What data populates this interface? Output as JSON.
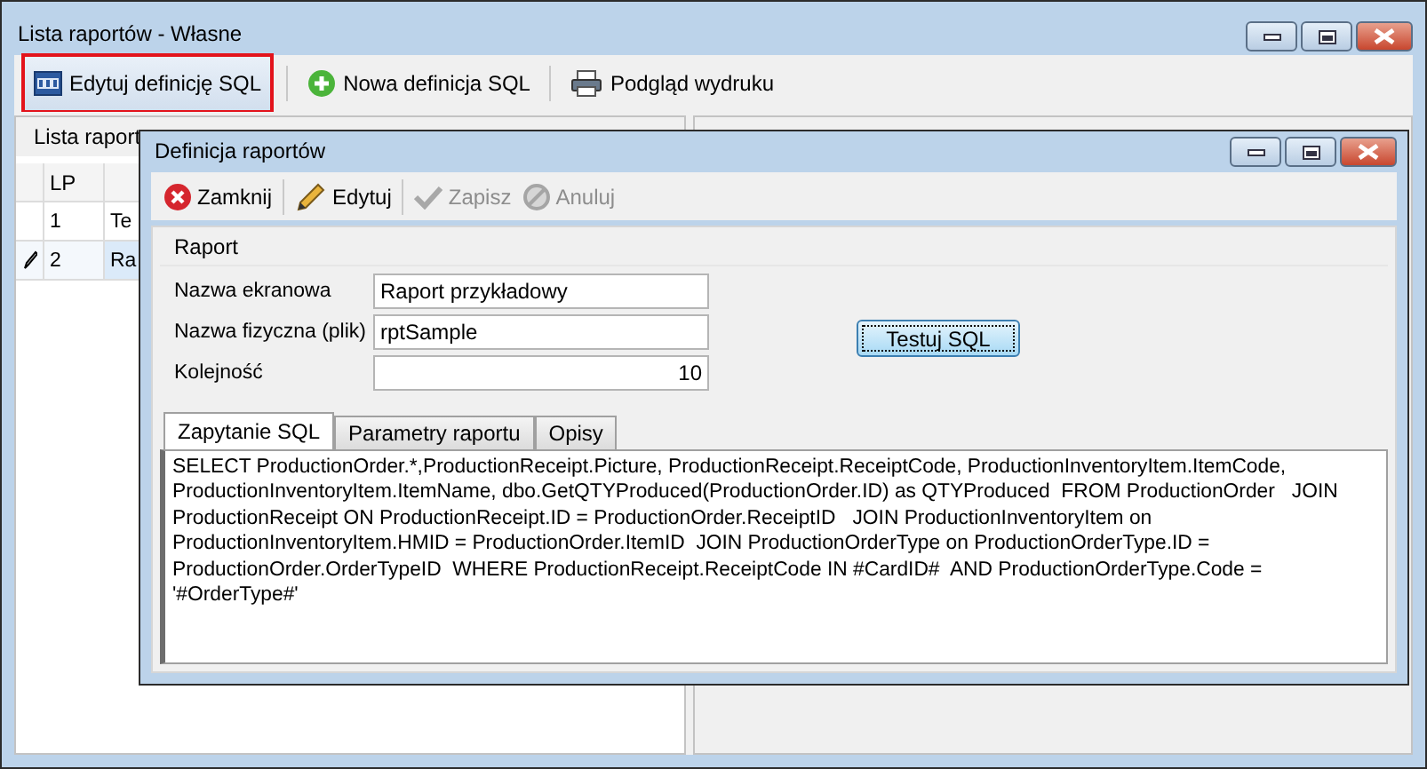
{
  "window": {
    "title": "Lista raportów - Własne"
  },
  "toolbar": [
    {
      "label": "Edytuj definicję SQL",
      "highlighted": true
    },
    {
      "label": "Nowa definicja SQL",
      "highlighted": false
    },
    {
      "label": "Podgląd wydruku",
      "highlighted": false
    }
  ],
  "list_panel": {
    "title": "Lista raport",
    "columns": [
      "LP"
    ],
    "rows": [
      {
        "lp": "1",
        "column_2": "Te",
        "selected": false,
        "editing": false
      },
      {
        "lp": "2",
        "column_2": "Ra",
        "selected": true,
        "editing": true
      }
    ]
  },
  "dialog": {
    "title": "Definicja raportów",
    "toolbar": [
      {
        "label": "Zamknij",
        "disabled": false
      },
      {
        "label": "Edytuj",
        "disabled": false
      },
      {
        "label": "Zapisz",
        "disabled": true
      },
      {
        "label": "Anuluj",
        "disabled": true
      }
    ],
    "group_title": "Raport",
    "fields": [
      {
        "label": "Nazwa ekranowa",
        "value": "Raport przykładowy",
        "numeric": false
      },
      {
        "label": "Nazwa fizyczna (plik)",
        "value": "rptSample",
        "numeric": false
      },
      {
        "label": "Kolejność",
        "value": "10",
        "numeric": true
      }
    ],
    "test_button": "Testuj SQL",
    "tabs": [
      {
        "label": "Zapytanie SQL",
        "selected": true
      },
      {
        "label": "Parametry raportu",
        "selected": false
      },
      {
        "label": "Opisy",
        "selected": false
      }
    ],
    "sql": "SELECT ProductionOrder.*,ProductionReceipt.Picture, ProductionReceipt.ReceiptCode, ProductionInventoryItem.ItemCode, ProductionInventoryItem.ItemName, dbo.GetQTYProduced(ProductionOrder.ID) as QTYProduced  FROM ProductionOrder   JOIN ProductionReceipt ON ProductionReceipt.ID = ProductionOrder.ReceiptID   JOIN ProductionInventoryItem on ProductionInventoryItem.HMID = ProductionOrder.ItemID  JOIN ProductionOrderType on ProductionOrderType.ID = ProductionOrder.OrderTypeID  WHERE ProductionReceipt.ReceiptCode IN #CardID#  AND ProductionOrderType.Code = '#OrderType#'"
  }
}
